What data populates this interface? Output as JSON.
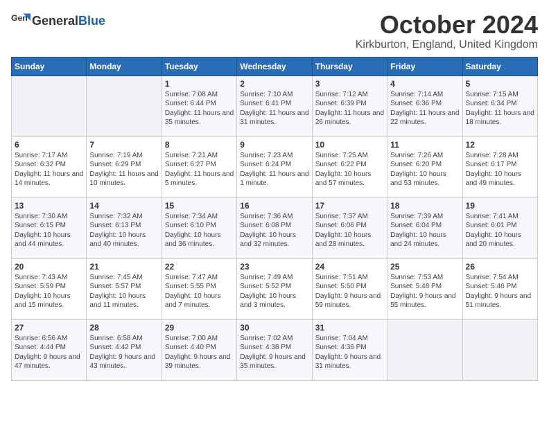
{
  "header": {
    "logo_general": "General",
    "logo_blue": "Blue",
    "month": "October 2024",
    "location": "Kirkburton, England, United Kingdom"
  },
  "weekdays": [
    "Sunday",
    "Monday",
    "Tuesday",
    "Wednesday",
    "Thursday",
    "Friday",
    "Saturday"
  ],
  "weeks": [
    [
      {
        "day": "",
        "empty": true
      },
      {
        "day": "",
        "empty": true
      },
      {
        "day": "1",
        "sunrise": "Sunrise: 7:08 AM",
        "sunset": "Sunset: 6:44 PM",
        "daylight": "Daylight: 11 hours and 35 minutes."
      },
      {
        "day": "2",
        "sunrise": "Sunrise: 7:10 AM",
        "sunset": "Sunset: 6:41 PM",
        "daylight": "Daylight: 11 hours and 31 minutes."
      },
      {
        "day": "3",
        "sunrise": "Sunrise: 7:12 AM",
        "sunset": "Sunset: 6:39 PM",
        "daylight": "Daylight: 11 hours and 26 minutes."
      },
      {
        "day": "4",
        "sunrise": "Sunrise: 7:14 AM",
        "sunset": "Sunset: 6:36 PM",
        "daylight": "Daylight: 11 hours and 22 minutes."
      },
      {
        "day": "5",
        "sunrise": "Sunrise: 7:15 AM",
        "sunset": "Sunset: 6:34 PM",
        "daylight": "Daylight: 11 hours and 18 minutes."
      }
    ],
    [
      {
        "day": "6",
        "sunrise": "Sunrise: 7:17 AM",
        "sunset": "Sunset: 6:32 PM",
        "daylight": "Daylight: 11 hours and 14 minutes."
      },
      {
        "day": "7",
        "sunrise": "Sunrise: 7:19 AM",
        "sunset": "Sunset: 6:29 PM",
        "daylight": "Daylight: 11 hours and 10 minutes."
      },
      {
        "day": "8",
        "sunrise": "Sunrise: 7:21 AM",
        "sunset": "Sunset: 6:27 PM",
        "daylight": "Daylight: 11 hours and 5 minutes."
      },
      {
        "day": "9",
        "sunrise": "Sunrise: 7:23 AM",
        "sunset": "Sunset: 6:24 PM",
        "daylight": "Daylight: 11 hours and 1 minute."
      },
      {
        "day": "10",
        "sunrise": "Sunrise: 7:25 AM",
        "sunset": "Sunset: 6:22 PM",
        "daylight": "Daylight: 10 hours and 57 minutes."
      },
      {
        "day": "11",
        "sunrise": "Sunrise: 7:26 AM",
        "sunset": "Sunset: 6:20 PM",
        "daylight": "Daylight: 10 hours and 53 minutes."
      },
      {
        "day": "12",
        "sunrise": "Sunrise: 7:28 AM",
        "sunset": "Sunset: 6:17 PM",
        "daylight": "Daylight: 10 hours and 49 minutes."
      }
    ],
    [
      {
        "day": "13",
        "sunrise": "Sunrise: 7:30 AM",
        "sunset": "Sunset: 6:15 PM",
        "daylight": "Daylight: 10 hours and 44 minutes."
      },
      {
        "day": "14",
        "sunrise": "Sunrise: 7:32 AM",
        "sunset": "Sunset: 6:13 PM",
        "daylight": "Daylight: 10 hours and 40 minutes."
      },
      {
        "day": "15",
        "sunrise": "Sunrise: 7:34 AM",
        "sunset": "Sunset: 6:10 PM",
        "daylight": "Daylight: 10 hours and 36 minutes."
      },
      {
        "day": "16",
        "sunrise": "Sunrise: 7:36 AM",
        "sunset": "Sunset: 6:08 PM",
        "daylight": "Daylight: 10 hours and 32 minutes."
      },
      {
        "day": "17",
        "sunrise": "Sunrise: 7:37 AM",
        "sunset": "Sunset: 6:06 PM",
        "daylight": "Daylight: 10 hours and 28 minutes."
      },
      {
        "day": "18",
        "sunrise": "Sunrise: 7:39 AM",
        "sunset": "Sunset: 6:04 PM",
        "daylight": "Daylight: 10 hours and 24 minutes."
      },
      {
        "day": "19",
        "sunrise": "Sunrise: 7:41 AM",
        "sunset": "Sunset: 6:01 PM",
        "daylight": "Daylight: 10 hours and 20 minutes."
      }
    ],
    [
      {
        "day": "20",
        "sunrise": "Sunrise: 7:43 AM",
        "sunset": "Sunset: 5:59 PM",
        "daylight": "Daylight: 10 hours and 15 minutes."
      },
      {
        "day": "21",
        "sunrise": "Sunrise: 7:45 AM",
        "sunset": "Sunset: 5:57 PM",
        "daylight": "Daylight: 10 hours and 11 minutes."
      },
      {
        "day": "22",
        "sunrise": "Sunrise: 7:47 AM",
        "sunset": "Sunset: 5:55 PM",
        "daylight": "Daylight: 10 hours and 7 minutes."
      },
      {
        "day": "23",
        "sunrise": "Sunrise: 7:49 AM",
        "sunset": "Sunset: 5:52 PM",
        "daylight": "Daylight: 10 hours and 3 minutes."
      },
      {
        "day": "24",
        "sunrise": "Sunrise: 7:51 AM",
        "sunset": "Sunset: 5:50 PM",
        "daylight": "Daylight: 9 hours and 59 minutes."
      },
      {
        "day": "25",
        "sunrise": "Sunrise: 7:53 AM",
        "sunset": "Sunset: 5:48 PM",
        "daylight": "Daylight: 9 hours and 55 minutes."
      },
      {
        "day": "26",
        "sunrise": "Sunrise: 7:54 AM",
        "sunset": "Sunset: 5:46 PM",
        "daylight": "Daylight: 9 hours and 51 minutes."
      }
    ],
    [
      {
        "day": "27",
        "sunrise": "Sunrise: 6:56 AM",
        "sunset": "Sunset: 4:44 PM",
        "daylight": "Daylight: 9 hours and 47 minutes."
      },
      {
        "day": "28",
        "sunrise": "Sunrise: 6:58 AM",
        "sunset": "Sunset: 4:42 PM",
        "daylight": "Daylight: 9 hours and 43 minutes."
      },
      {
        "day": "29",
        "sunrise": "Sunrise: 7:00 AM",
        "sunset": "Sunset: 4:40 PM",
        "daylight": "Daylight: 9 hours and 39 minutes."
      },
      {
        "day": "30",
        "sunrise": "Sunrise: 7:02 AM",
        "sunset": "Sunset: 4:38 PM",
        "daylight": "Daylight: 9 hours and 35 minutes."
      },
      {
        "day": "31",
        "sunrise": "Sunrise: 7:04 AM",
        "sunset": "Sunset: 4:36 PM",
        "daylight": "Daylight: 9 hours and 31 minutes."
      },
      {
        "day": "",
        "empty": true
      },
      {
        "day": "",
        "empty": true
      }
    ]
  ]
}
